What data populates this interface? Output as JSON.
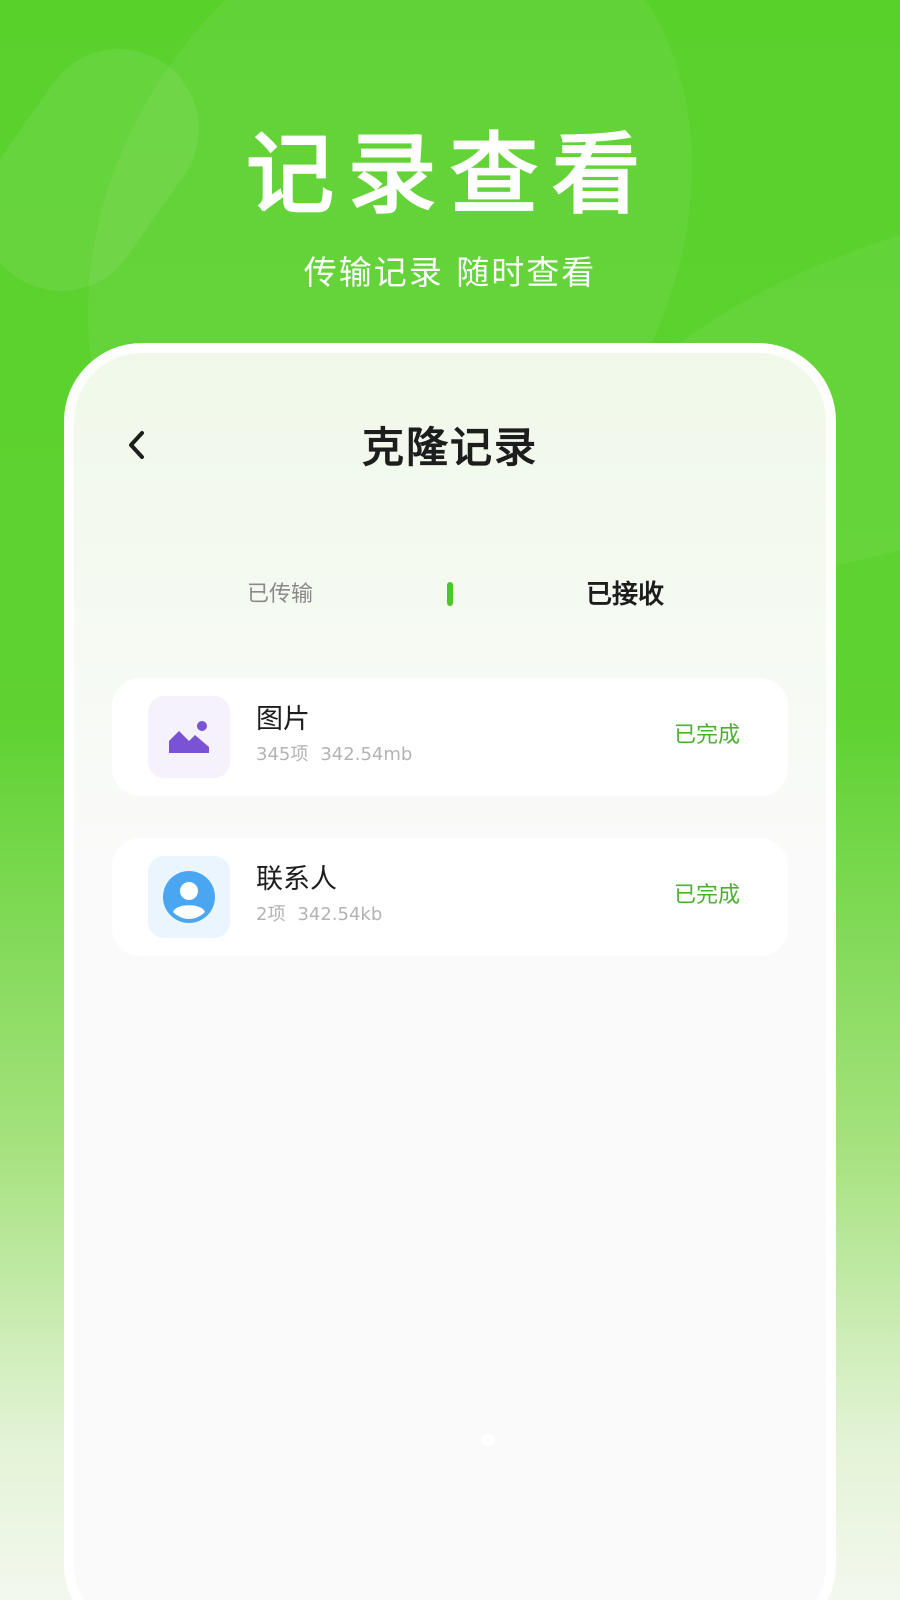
{
  "hero": {
    "title": "记录查看",
    "subtitle": "传输记录  随时查看"
  },
  "nav": {
    "back_icon": "chevron-left-icon",
    "title": "克隆记录"
  },
  "tabs": [
    {
      "label": "已传输",
      "active": false
    },
    {
      "label": "已接收",
      "active": true
    }
  ],
  "records": [
    {
      "icon": "image-icon",
      "name": "图片",
      "count": "345项",
      "size": "342.54mb",
      "status": "已完成"
    },
    {
      "icon": "contact-icon",
      "name": "联系人",
      "count": "2项",
      "size": "342.54kb",
      "status": "已完成"
    }
  ],
  "colors": {
    "brand_green": "#59d12b",
    "status_green": "#4caf33",
    "image_icon_purple": "#7a52d6",
    "contact_icon_blue": "#4aa6f0"
  }
}
